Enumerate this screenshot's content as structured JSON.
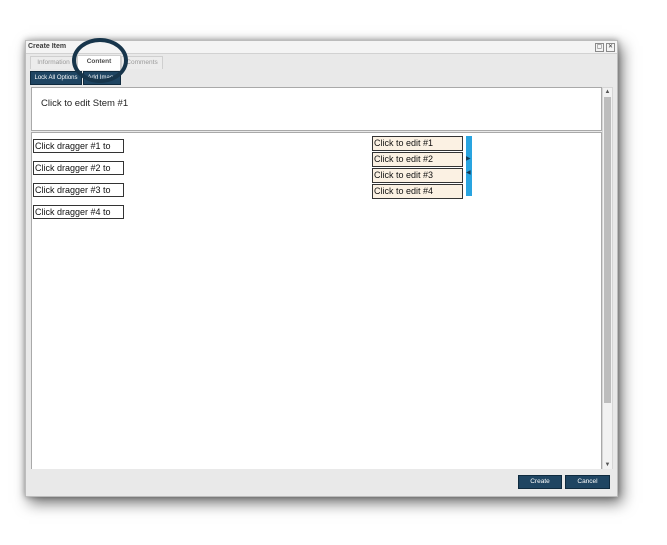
{
  "window": {
    "title": "Create Item",
    "restore_glyph": "▢",
    "close_glyph": "✕"
  },
  "tabs": [
    {
      "label": "Information",
      "active": false
    },
    {
      "label": "Content",
      "active": true
    },
    {
      "label": "Comments",
      "active": false
    }
  ],
  "toolbar": {
    "lock_label": "Lock All Options",
    "add_image_label": "Add Image"
  },
  "stem": {
    "text": "Click to edit Stem #1"
  },
  "draggers": [
    "Click dragger #1 to",
    "Click dragger #2 to",
    "Click dragger #3 to",
    "Click dragger #4 to"
  ],
  "targets": [
    "Click to edit #1",
    "Click to edit #2",
    "Click to edit #3",
    "Click to edit #4"
  ],
  "scrollbar": {
    "up_glyph": "▲",
    "down_glyph": "▼"
  },
  "footer": {
    "create_label": "Create",
    "cancel_label": "Cancel"
  },
  "colors": {
    "accent_button": "#1f4562",
    "target_fill": "#fbf1e3",
    "handle_blue": "#29a4e0",
    "highlight_ring": "#17354b"
  }
}
